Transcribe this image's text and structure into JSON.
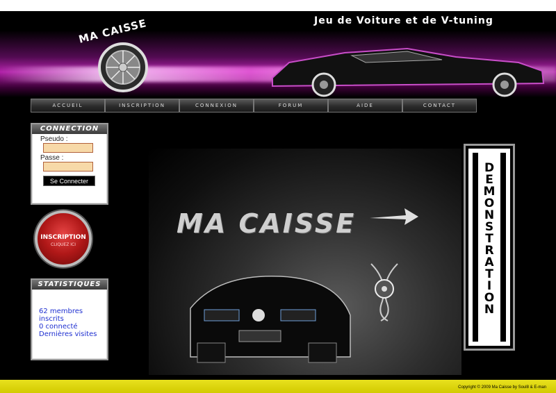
{
  "banner": {
    "tagline": "Jeu de Voiture et de V-tuning",
    "logo_text": "MA CAISSE"
  },
  "nav": {
    "items": [
      "ACCUEIL",
      "INSCRIPTION",
      "CONNEXION",
      "FORUM",
      "AIDE",
      "CONTACT"
    ]
  },
  "login": {
    "title": "CONNECTION",
    "pseudo_label": "Pseudo :",
    "passe_label": "Passe :",
    "connect_label": "Se Connecter"
  },
  "inscription_button": {
    "line1": "INSCRIPTION",
    "line2": "CLIQUEZ ICI"
  },
  "stats": {
    "title": "STATISTIQUES",
    "members": "62 membres inscrits",
    "connected": "0 connecté",
    "recent": "Dernières visites"
  },
  "showcase": {
    "title": "MA CAISSE"
  },
  "demo": {
    "letters": [
      "D",
      "E",
      "M",
      "O",
      "N",
      "S",
      "T",
      "R",
      "A",
      "T",
      "I",
      "O",
      "N"
    ]
  },
  "footer": {
    "copyright": "Copyright © 2009 Ma Caisse by Soul8 & E-man"
  },
  "colors": {
    "accent_magenta": "#d22ad0",
    "stats_link": "#1e2fd0",
    "footer_yellow": "#e0d80e",
    "input_bg": "#f7d9a8"
  }
}
